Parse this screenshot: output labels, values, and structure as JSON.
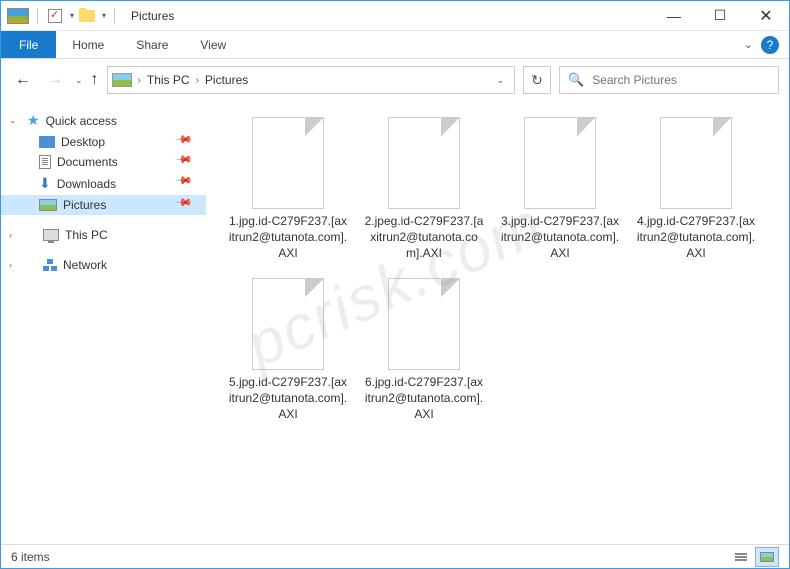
{
  "window": {
    "title": "Pictures"
  },
  "ribbon": {
    "file": "File",
    "tabs": [
      "Home",
      "Share",
      "View"
    ]
  },
  "breadcrumb": {
    "parts": [
      "This PC",
      "Pictures"
    ]
  },
  "search": {
    "placeholder": "Search Pictures"
  },
  "sidebar": {
    "quick_access": {
      "label": "Quick access",
      "items": [
        {
          "label": "Desktop",
          "icon": "desktop",
          "pinned": true
        },
        {
          "label": "Documents",
          "icon": "document",
          "pinned": true
        },
        {
          "label": "Downloads",
          "icon": "download",
          "pinned": true
        },
        {
          "label": "Pictures",
          "icon": "pictures",
          "pinned": true,
          "selected": true
        }
      ]
    },
    "this_pc": {
      "label": "This PC"
    },
    "network": {
      "label": "Network"
    }
  },
  "files": [
    {
      "name": "1.jpg.id-C279F237.[axitrun2@tutanota.com].AXI"
    },
    {
      "name": "2.jpeg.id-C279F237.[axitrun2@tutanota.com].AXI"
    },
    {
      "name": "3.jpg.id-C279F237.[axitrun2@tutanota.com].AXI"
    },
    {
      "name": "4.jpg.id-C279F237.[axitrun2@tutanota.com].AXI"
    },
    {
      "name": "5.jpg.id-C279F237.[axitrun2@tutanota.com].AXI"
    },
    {
      "name": "6.jpg.id-C279F237.[axitrun2@tutanota.com].AXI"
    }
  ],
  "status": {
    "item_count": "6 items"
  },
  "watermark": "pcrisk.com"
}
